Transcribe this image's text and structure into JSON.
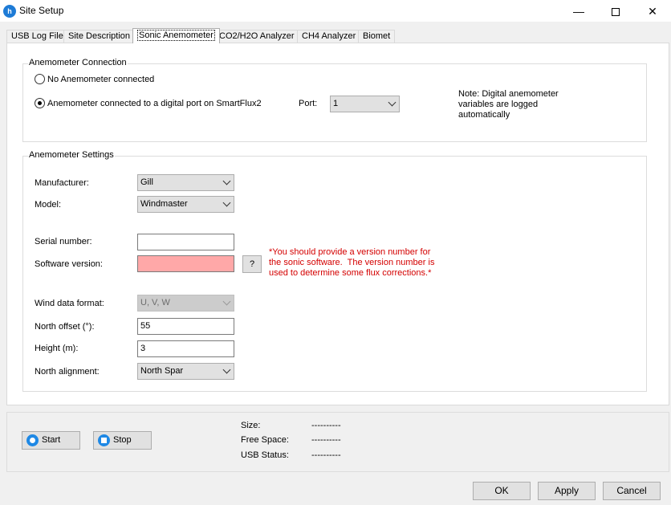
{
  "window": {
    "title": "Site Setup",
    "minimize_glyph": "—",
    "close_glyph": "✕"
  },
  "tabs": [
    {
      "label": "USB Log File"
    },
    {
      "label": "Site Description"
    },
    {
      "label": "Sonic Anemometer",
      "active": true
    },
    {
      "label": "CO2/H2O Analyzer"
    },
    {
      "label": "CH4 Analyzer"
    },
    {
      "label": "Biomet"
    }
  ],
  "connection": {
    "group_label": "Anemometer Connection",
    "option_none": "No Anemometer connected",
    "option_digital": "Anemometer connected to a digital port on SmartFlux2",
    "selected": "digital",
    "port_label": "Port:",
    "port_value": "1",
    "note": "Note: Digital anemometer\nvariables are logged\nautomatically"
  },
  "settings": {
    "group_label": "Anemometer Settings",
    "manufacturer_label": "Manufacturer:",
    "manufacturer_value": "Gill",
    "model_label": "Model:",
    "model_value": "Windmaster",
    "serial_label": "Serial number:",
    "serial_value": "",
    "software_label": "Software version:",
    "software_value": "",
    "help_label": "?",
    "software_warning": "*You should provide a version number for\nthe sonic software.  The version number is\nused to determine some flux corrections.*",
    "wind_format_label": "Wind data format:",
    "wind_format_value": "U, V, W",
    "north_offset_label": "North offset (°):",
    "north_offset_value": "55",
    "height_label": "Height (m):",
    "height_value": "3",
    "north_alignment_label": "North alignment:",
    "north_alignment_value": "North Spar"
  },
  "status": {
    "start_label": "Start",
    "stop_label": "Stop",
    "size_label": "Size:",
    "size_value": "----------",
    "free_space_label": "Free Space:",
    "free_space_value": "----------",
    "usb_status_label": "USB Status:",
    "usb_status_value": "----------"
  },
  "dialog": {
    "ok_label": "OK",
    "apply_label": "Apply",
    "cancel_label": "Cancel"
  },
  "colors": {
    "error_field": "#ffa8a8",
    "warning_text": "#d40000",
    "accent": "#1e88e5"
  }
}
